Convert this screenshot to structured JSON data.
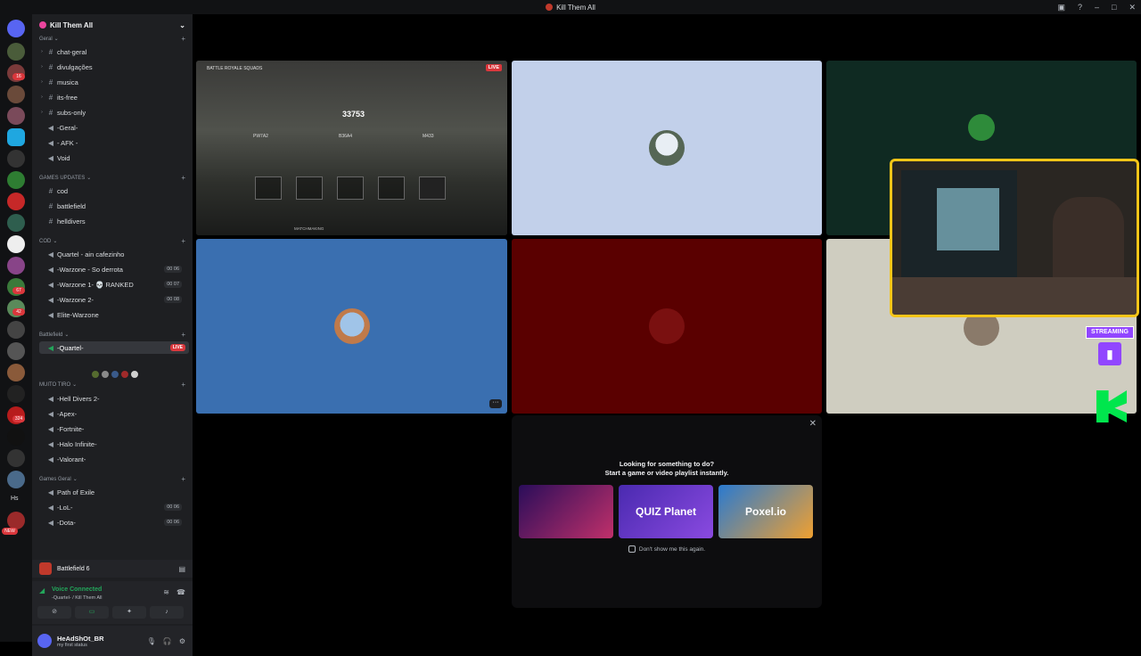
{
  "window": {
    "title": "Kill Them All"
  },
  "server": {
    "name": "Kill Them All"
  },
  "server_rail": {
    "badges": [
      "16",
      "67",
      "42",
      "324",
      "NEW"
    ],
    "label_hs": "Hs"
  },
  "categories": [
    {
      "label": "Geral"
    },
    {
      "label": "GAMES UPDATES"
    },
    {
      "label": "COD"
    },
    {
      "label": "Battlefield"
    },
    {
      "label": "MUITO TIRO"
    },
    {
      "label": "Games Geral"
    }
  ],
  "channels": {
    "chat_geral": "chat-geral",
    "divulgacoes": "divulgações",
    "musica": "musica",
    "its_free": "its-free",
    "subs_only": "subs-only",
    "geral_voice": "-Geral-",
    "afk": "- AFK -",
    "void": "Void",
    "cod": "cod",
    "battlefield": "battlefield",
    "helldivers": "helldivers",
    "quartel_cafe": "Quartel - ain cafezinho",
    "warzone_derrota": "-Warzone - So derrota",
    "warzone_ranked": "-Warzone 1- 💀 RANKED",
    "warzone2": "-Warzone 2-",
    "elite_warzone": "Elite-Warzone",
    "quartel": "-Quartel-",
    "hell_divers2": "-Hell Divers 2-",
    "apex": "-Apex-",
    "fortnite": "-Fortnite-",
    "halo": "-Halo Infinite-",
    "valorant": "-Valorant-",
    "path_of_exile": "Path of Exile",
    "lol": "-LoL-",
    "dota": "-Dota-"
  },
  "counts": {
    "warzone_derrota": "00 06",
    "warzone_ranked": "00 07",
    "warzone2": "00 08",
    "lol": "00 06",
    "dota": "00 06"
  },
  "live_label": "LIVE",
  "activity_row": {
    "label": "Battlefield 6"
  },
  "voice_panel": {
    "status": "Voice Connected",
    "location": "-Quartel- / Kill Them All"
  },
  "user": {
    "name": "HeAdShOt_BR",
    "status": "my first status"
  },
  "stream_tile": {
    "title": "BATTLE ROYALE SQUADS",
    "score": "33753",
    "live": "LIVE",
    "weapons": [
      "PW7A2",
      "B36A4",
      "M433"
    ],
    "bottom": "MATCHMAKING"
  },
  "overlay": {
    "streaming": "STREAMING"
  },
  "activity_card": {
    "heading": "Looking for something to do?",
    "subheading": "Start a game or video playlist instantly.",
    "games": [
      {
        "name": "",
        "color": "#3a1a5c"
      },
      {
        "name": "QUIZ Planet",
        "color": "#6a3ad0"
      },
      {
        "name": "Poxel.io",
        "color": "#3b8fd6"
      }
    ],
    "optout": "Don't show me this again."
  },
  "colors": {
    "tile_light_blue": "#c2d0ea",
    "tile_dark_teal": "#0f2a22",
    "tile_blue": "#3a6fb0",
    "tile_dark_red": "#5a0000",
    "tile_beige": "#cfcdc0",
    "accent_live": "#da373c",
    "twitch": "#9146ff"
  }
}
